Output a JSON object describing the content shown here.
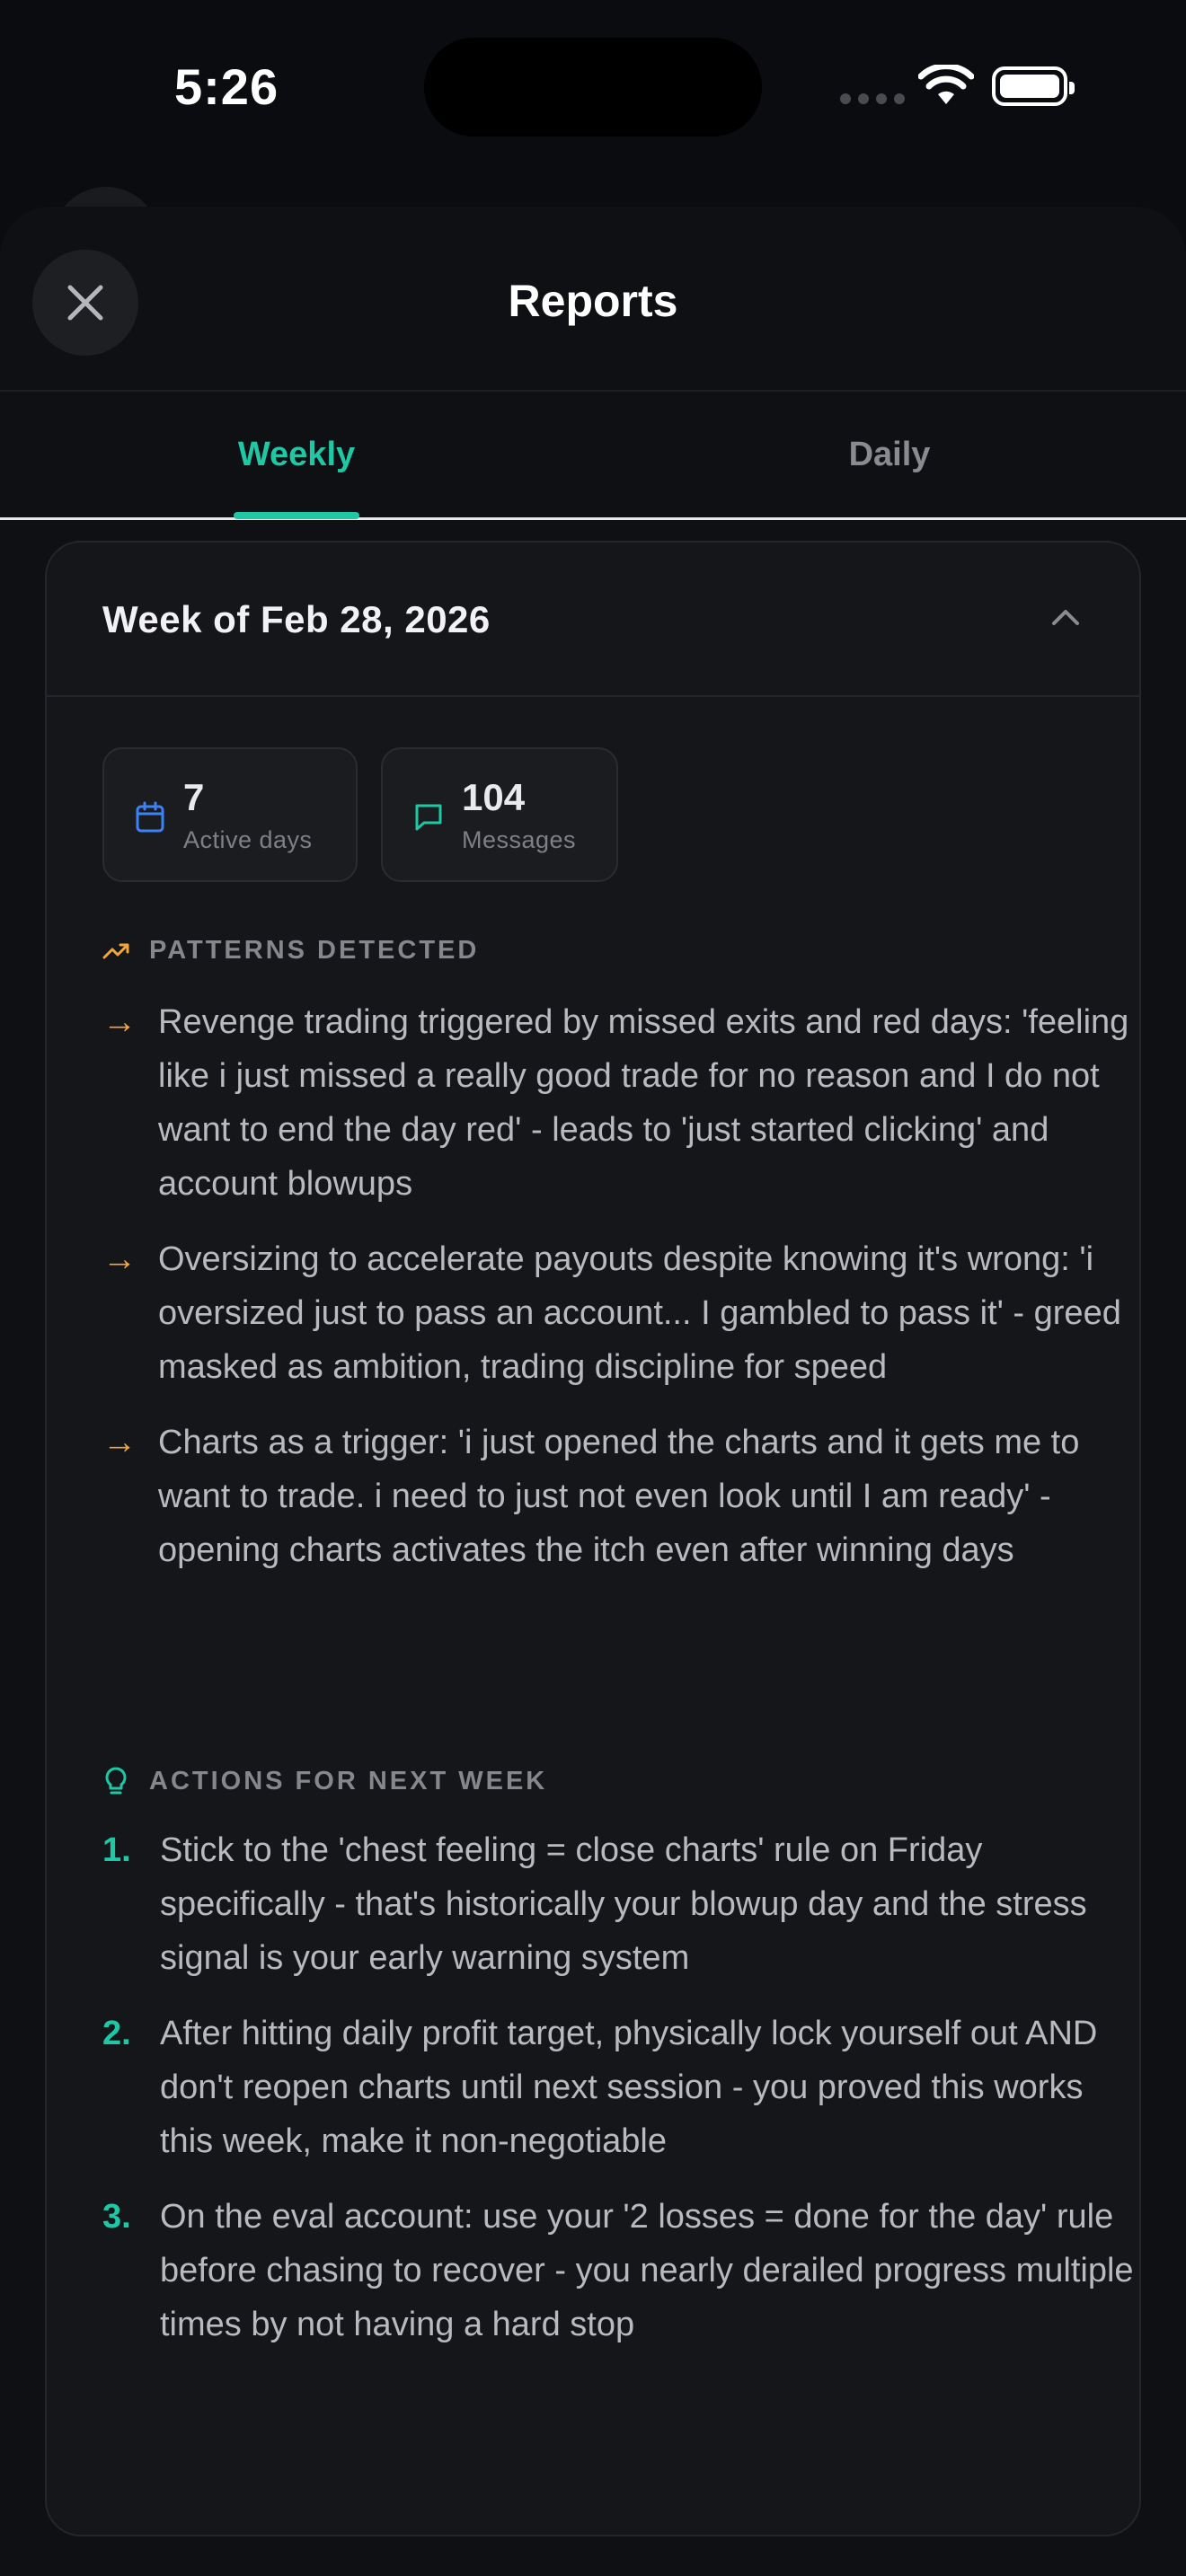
{
  "status_bar": {
    "time": "5:26"
  },
  "sheet": {
    "title": "Reports"
  },
  "tabs": {
    "weekly": "Weekly",
    "daily": "Daily",
    "active": "Weekly"
  },
  "card": {
    "title": "Week of Feb 28, 2026",
    "stats": {
      "active_days": {
        "value": "7",
        "label": "Active days"
      },
      "messages": {
        "value": "104",
        "label": "Messages"
      }
    },
    "patterns": {
      "heading": "PATTERNS DETECTED",
      "items": [
        "Revenge trading triggered by missed exits and red days: 'feeling like i just missed a really good trade for no reason and I do not want to end the day red' - leads to 'just started clicking' and account blowups",
        "Oversizing to accelerate payouts despite knowing it's wrong: 'i oversized just to pass an account... I gambled to pass it' - greed masked as ambition, trading discipline for speed",
        "Charts as a trigger: 'i just opened the charts and it gets me to want to trade. i need to just not even look until I am ready' - opening charts activates the itch even after winning days"
      ]
    },
    "actions": {
      "heading": "ACTIONS FOR NEXT WEEK",
      "items": [
        {
          "num": "1.",
          "text": "Stick to the 'chest feeling = close charts' rule on Friday specifically - that's historically your blowup day and the stress signal is your early warning system"
        },
        {
          "num": "2.",
          "text": "After hitting daily profit target, physically lock yourself out AND don't reopen charts until next session - you proved this works this week, make it non-negotiable"
        },
        {
          "num": "3.",
          "text": "On the eval account: use your '2 losses = done for the day' rule before chasing to recover - you nearly derailed progress multiple times by not having a hard stop"
        }
      ]
    }
  },
  "colors": {
    "accent": "#1fc7a5",
    "warning": "#f4a53b",
    "info": "#3b82f6",
    "background": "#0b0c0f"
  },
  "icons": [
    "close-icon",
    "chevron-up-icon",
    "calendar-icon",
    "message-icon",
    "trending-up-icon",
    "lightbulb-icon",
    "arrow-right-icon",
    "wifi-icon",
    "battery-icon"
  ]
}
